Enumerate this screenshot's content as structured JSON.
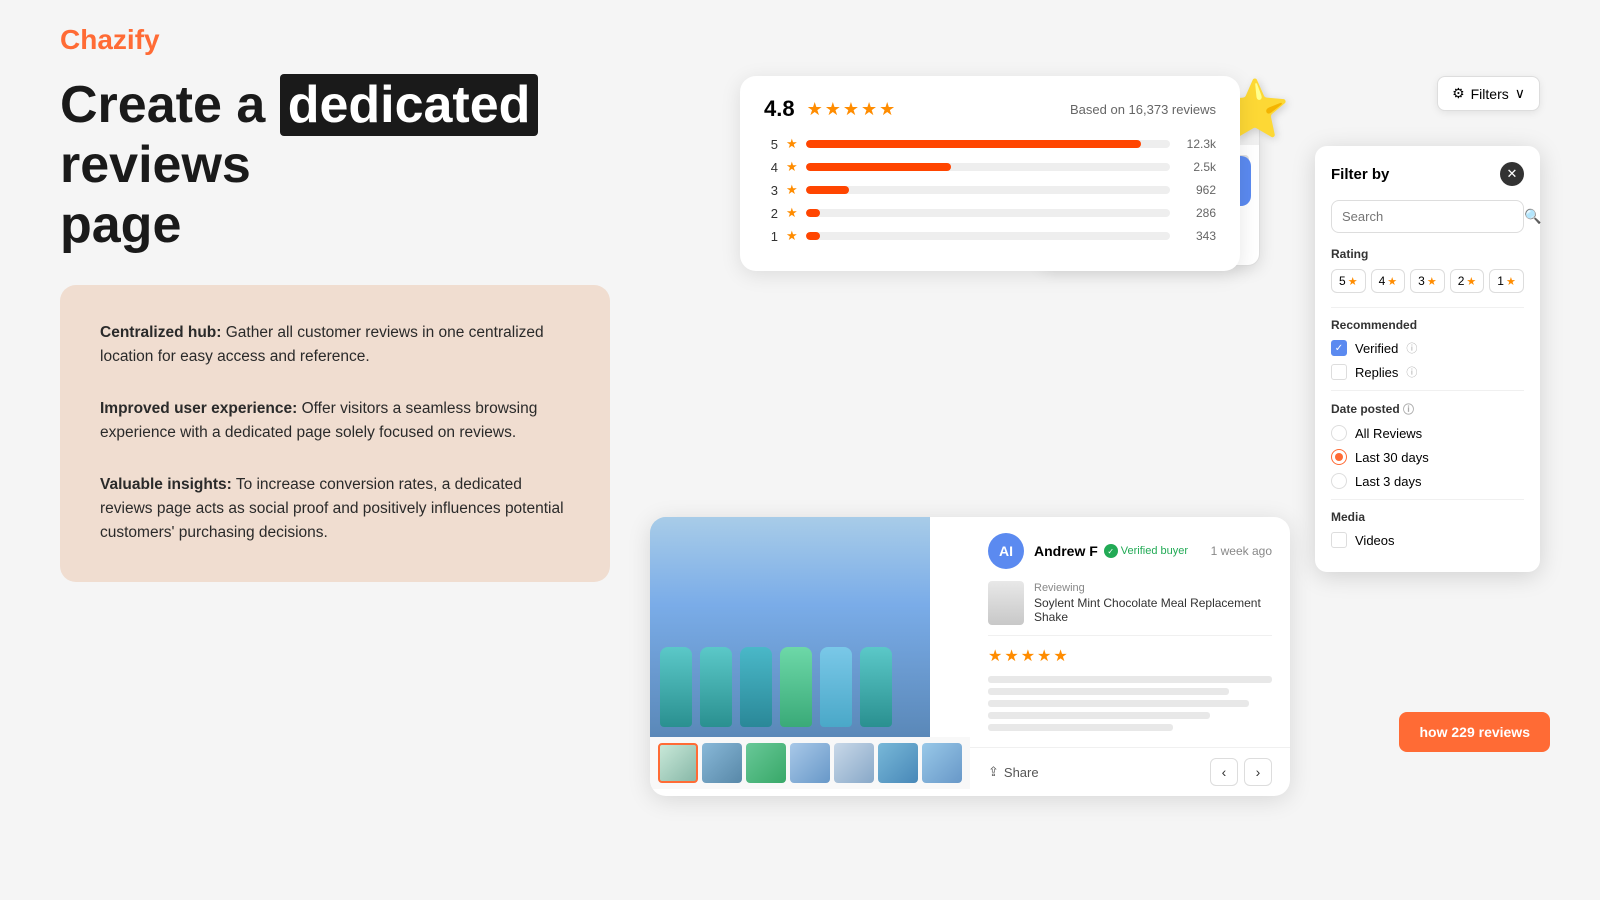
{
  "app": {
    "logo_text": "Chazify",
    "logo_accent": "fy"
  },
  "headline": {
    "part1": "Create a ",
    "highlight": "dedicated",
    "part2": " reviews",
    "part3": "page"
  },
  "features": [
    {
      "title": "Centralized hub:",
      "description": "Gather all customer reviews in one centralized location for easy access and reference."
    },
    {
      "title": "Improved user experience:",
      "description": "Offer visitors a seamless browsing experience with a dedicated page solely focused on reviews."
    },
    {
      "title": "Valuable insights:",
      "description": "To increase conversion rates, a dedicated reviews page acts as social proof and positively influences potential customers' purchasing decisions."
    }
  ],
  "rating_card": {
    "score": "4.8",
    "based_on": "Based on 16,373 reviews",
    "bars": [
      {
        "label": "5",
        "fill": 92,
        "count": "12.3k"
      },
      {
        "label": "4",
        "fill": 40,
        "count": "2.5k"
      },
      {
        "label": "3",
        "fill": 12,
        "count": "962"
      },
      {
        "label": "2",
        "fill": 4,
        "count": "286"
      },
      {
        "label": "1",
        "fill": 4,
        "count": "343"
      }
    ]
  },
  "review": {
    "avatar_initials": "AI",
    "reviewer_name": "Andrew F",
    "verified_label": "Verified buyer",
    "time_ago": "1 week ago",
    "reviewing_label": "Reviewing",
    "product_name": "Soylent Mint Chocolate Meal Replacement Shake",
    "share_label": "Share",
    "show_reviews_btn": "how 229 reviews"
  },
  "filter_panel": {
    "title": "Filter by",
    "search_placeholder": "Search",
    "search_label": "Search",
    "rating_section": "Rating",
    "rating_options": [
      "5",
      "4",
      "3",
      "2",
      "1"
    ],
    "recommended_section": "Recommended",
    "verified_label": "Verified",
    "replies_label": "Replies",
    "date_posted_section": "Date posted",
    "date_options": [
      "All Reviews",
      "Last 30 days",
      "Last 3 days"
    ],
    "media_section": "Media",
    "media_option": "Videos"
  },
  "filters_button": {
    "label": "Filters",
    "icon": "filter-icon"
  }
}
